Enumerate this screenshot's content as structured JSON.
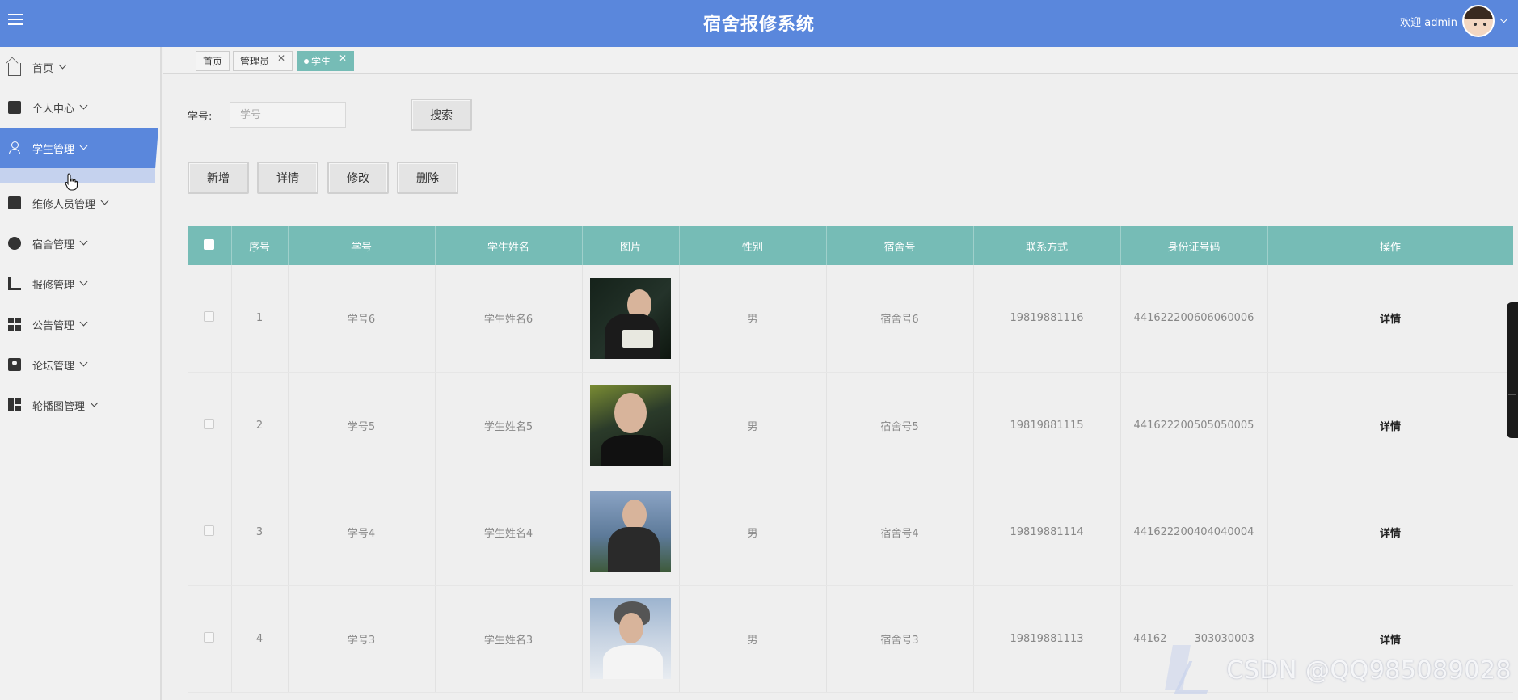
{
  "header": {
    "title": "宿舍报修系统",
    "welcome": "欢迎 admin"
  },
  "sidebar": {
    "items": [
      {
        "label": "首页",
        "icon": "home-icon"
      },
      {
        "label": "个人中心",
        "icon": "wallet-icon"
      },
      {
        "label": "学生管理",
        "icon": "user-icon",
        "active": true
      },
      {
        "label": "维修人员管理",
        "icon": "ticket-icon"
      },
      {
        "label": "宿舍管理",
        "icon": "compass-icon"
      },
      {
        "label": "报修管理",
        "icon": "crop-icon"
      },
      {
        "label": "公告管理",
        "icon": "grid-icon"
      },
      {
        "label": "论坛管理",
        "icon": "idcard-icon"
      },
      {
        "label": "轮播图管理",
        "icon": "layout-icon"
      }
    ]
  },
  "tabs": [
    {
      "label": "首页"
    },
    {
      "label": "管理员",
      "closable": true
    },
    {
      "label": "学生",
      "closable": true,
      "active": true
    }
  ],
  "search": {
    "label": "学号:",
    "placeholder": "学号",
    "button": "搜索"
  },
  "actions": {
    "add": "新增",
    "detail": "详情",
    "edit": "修改",
    "delete": "删除"
  },
  "table": {
    "columns": [
      "序号",
      "学号",
      "学生姓名",
      "图片",
      "性别",
      "宿舍号",
      "联系方式",
      "身份证号码",
      "操作"
    ],
    "rows": [
      {
        "index": "1",
        "student_id": "学号6",
        "name": "学生姓名6",
        "gender": "男",
        "dorm": "宿舍号6",
        "phone": "19819881116",
        "id_card": "441622200606060006",
        "op": "详情"
      },
      {
        "index": "2",
        "student_id": "学号5",
        "name": "学生姓名5",
        "gender": "男",
        "dorm": "宿舍号5",
        "phone": "19819881115",
        "id_card": "441622200505050005",
        "op": "详情"
      },
      {
        "index": "3",
        "student_id": "学号4",
        "name": "学生姓名4",
        "gender": "男",
        "dorm": "宿舍号4",
        "phone": "19819881114",
        "id_card": "441622200404040004",
        "op": "详情"
      },
      {
        "index": "4",
        "student_id": "学号3",
        "name": "学生姓名3",
        "gender": "男",
        "dorm": "宿舍号3",
        "phone": "19819881113",
        "id_card": "44162",
        "id_card_tail": "303030003",
        "op": "详情"
      }
    ]
  },
  "watermark": "CSDN @QQ985089028",
  "colors": {
    "header": "#5a87dc",
    "table_header": "#76bcb6",
    "active_tab": "#76bcb6"
  }
}
